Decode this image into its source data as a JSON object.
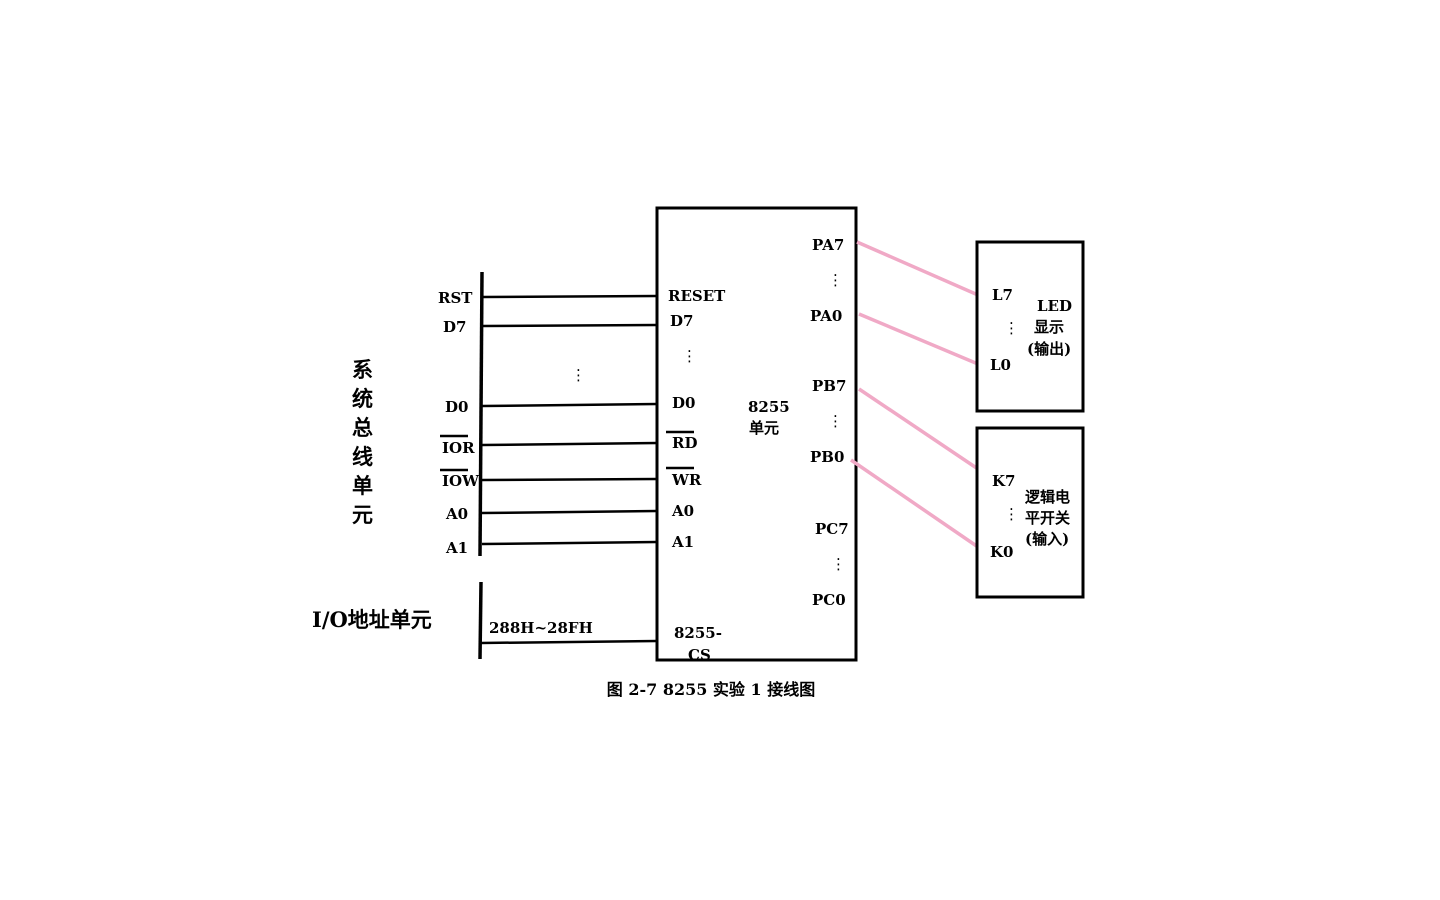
{
  "system_bus": {
    "title_chars": [
      "系",
      "统",
      "总",
      "线",
      "单",
      "元"
    ],
    "signals": [
      "RST",
      "D7",
      "D0",
      "IOR",
      "IOW",
      "A0",
      "A1"
    ]
  },
  "io_address": {
    "title": "I/O地址单元",
    "range": "288H~28FH"
  },
  "chip": {
    "name_line1": "8255",
    "name_line2": "单元",
    "left_pins": [
      "RESET",
      "D7",
      "D0",
      "RD",
      "WR",
      "A0",
      "A1"
    ],
    "cs_line1": "8255-",
    "cs_line2": "CS",
    "right_pins": [
      "PA7",
      "PA0",
      "PB7",
      "PB0",
      "PC7",
      "PC0"
    ]
  },
  "led_unit": {
    "pins": [
      "L7",
      "L0"
    ],
    "title_line1": "LED",
    "title_line2": "显示",
    "title_line3": "(输出)"
  },
  "switch_unit": {
    "pins": [
      "K7",
      "K0"
    ],
    "title_line1": "逻辑电",
    "title_line2": "平开关",
    "title_line3": "(输入)"
  },
  "ellipsis": "⋮",
  "caption": "图 2-7 8255 实验 1 接线图",
  "colors": {
    "wire": "#000000",
    "jumper": "#f0a9c6"
  }
}
